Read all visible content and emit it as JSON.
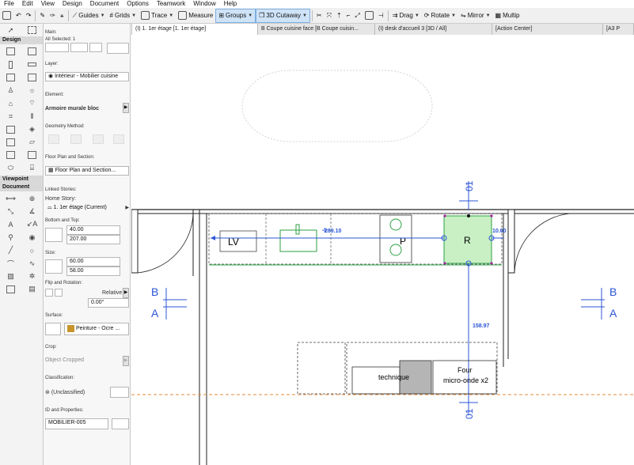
{
  "menu": [
    "File",
    "Edit",
    "View",
    "Design",
    "Document",
    "Options",
    "Teamwork",
    "Window",
    "Help"
  ],
  "toolbar": {
    "guides": "Guides",
    "grids": "Grids",
    "trace": "Trace",
    "measure": "Measure",
    "groups": "Groups",
    "cutaway": "3D Cutaway",
    "drag": "Drag",
    "rotate": "Rotate",
    "mirror": "Mirror",
    "multiply": "Multip"
  },
  "tabs": [
    "(I) 1. 1er étage [1. 1er étage]",
    "B Coupe cuisine face [B Coupe cuisin...",
    "(I) desk d'accueil 3 [3D / All]",
    "[Action Center]",
    "[A3 P"
  ],
  "toolbox": {
    "design": "Design",
    "viewpoint": "Viewpoint",
    "document": "Document"
  },
  "info_box": {
    "main_label": "Main:",
    "all_selected": "All Selected: 1",
    "layer_label": "Layer:",
    "layer_value": "Intérieur - Mobilier cuisine",
    "element_label": "Element:",
    "element_value": "Armoire murale bloc",
    "geometry_label": "Geometry Method:",
    "floor_plan_label": "Floor Plan and Section:",
    "floor_plan_value": "Floor Plan and Section...",
    "linked_stories_label": "Linked Stories:",
    "home_story_label": "Home Story:",
    "home_story_value": "1. 1er étage (Current)",
    "bottom_top_label": "Bottom and Top:",
    "top_value": "40.00",
    "bottom_value": "207.00",
    "size_label": "Size:",
    "width_value": "60.00",
    "depth_value": "58.00",
    "flip_label": "Flip and Rotation:",
    "relative": "Relative",
    "angle_value": "0.00°",
    "surface_label": "Surface:",
    "surface_value": "Peinture - Ocre ...",
    "crop_label": "Crop:",
    "crop_value": "Object Cropped",
    "classification_label": "Classification:",
    "classification_value": "(Unclassified)",
    "id_label": "ID and Properties:",
    "id_value": "MOBILIER-005"
  },
  "drawing": {
    "lv": "LV",
    "p": "P",
    "r": "R",
    "dim1": "289.10",
    "dim2": "10.00",
    "dim3": "158.97",
    "technique": "technique",
    "four": "Four",
    "microonde": "micro-onde x2",
    "section_b": "B",
    "section_a": "A",
    "elev_top": "01",
    "elev_bottom": "01"
  },
  "colors": {
    "dim_blue": "#2b54d6",
    "green": "#2ea043",
    "selected_fill": "#c8f0c4",
    "orange_line": "#e58a3a"
  }
}
